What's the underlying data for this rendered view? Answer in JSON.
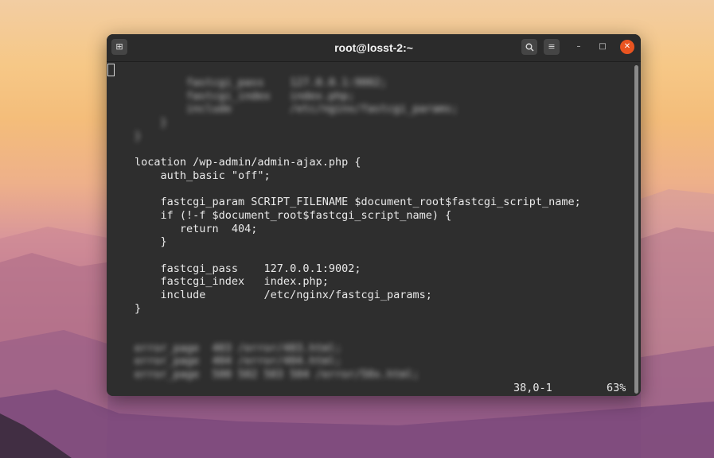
{
  "window": {
    "title": "root@losst-2:~",
    "buttons": {
      "new_tab_icon": "new-tab-icon",
      "new_tab_glyph": "⊞",
      "search_icon": "search-icon",
      "search_glyph": "🔍",
      "menu_icon": "hamburger-menu-icon",
      "menu_glyph": "≡",
      "minimize_glyph": "–",
      "maximize_glyph": "□",
      "close_glyph": "✕"
    },
    "colors": {
      "close": "#e95420",
      "terminal_bg": "#2e2e2e",
      "text": "#e9e9e9"
    }
  },
  "editor": {
    "lines": [
      {
        "text": "        fastcgi_pass    127.0.0.1:9002;",
        "blurred": true
      },
      {
        "text": "        fastcgi_index   index.php;",
        "blurred": true
      },
      {
        "text": "        include         /etc/nginx/fastcgi_params;",
        "blurred": true
      },
      {
        "text": "    }",
        "blurred": true
      },
      {
        "text": "}",
        "blurred": true
      },
      {
        "text": "",
        "blurred": false
      },
      {
        "text": "location /wp-admin/admin-ajax.php {",
        "blurred": false
      },
      {
        "text": "    auth_basic \"off\";",
        "blurred": false
      },
      {
        "text": "",
        "blurred": false
      },
      {
        "text": "    fastcgi_param SCRIPT_FILENAME $document_root$fastcgi_script_name;",
        "blurred": false
      },
      {
        "text": "    if (!-f $document_root$fastcgi_script_name) {",
        "blurred": false
      },
      {
        "text": "       return  404;",
        "blurred": false
      },
      {
        "text": "    }",
        "blurred": false
      },
      {
        "text": "",
        "blurred": false
      },
      {
        "text": "    fastcgi_pass    127.0.0.1:9002;",
        "blurred": false
      },
      {
        "text": "    fastcgi_index   index.php;",
        "blurred": false
      },
      {
        "text": "    include         /etc/nginx/fastcgi_params;",
        "blurred": false
      },
      {
        "text": "}",
        "blurred": false
      },
      {
        "text": "",
        "blurred": false
      },
      {
        "text": "",
        "blurred": false
      },
      {
        "text": "error_page  403 /error/403.html;",
        "blurred": true
      },
      {
        "text": "error_page  404 /error/404.html;",
        "blurred": true
      },
      {
        "text": "error_page  500 502 503 504 /error/50x.html;",
        "blurred": true
      }
    ]
  },
  "status_bar": {
    "position": "38,0-1",
    "percent": "63%"
  }
}
